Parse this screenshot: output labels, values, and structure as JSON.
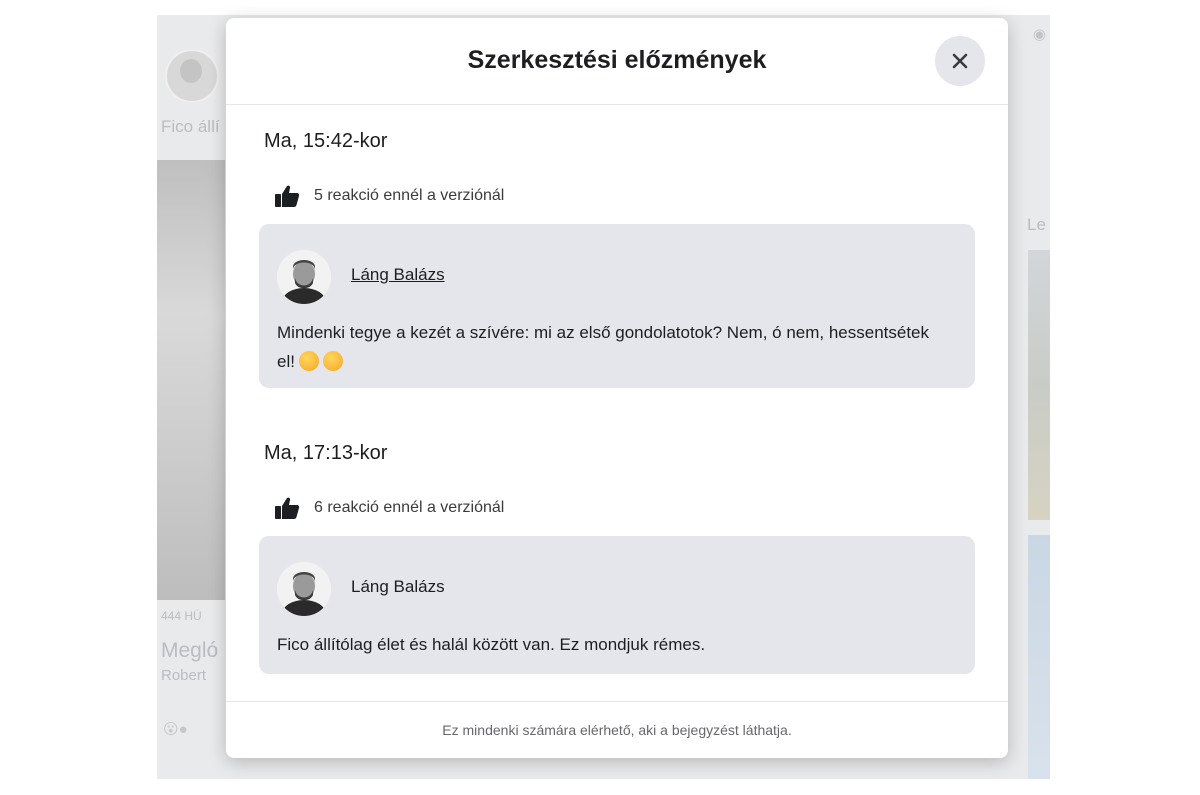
{
  "background": {
    "author_snippet": "Fico állí",
    "headline_snippet": "Megló",
    "subline_snippet": "Robert",
    "count_snippet": "444 HÚ",
    "side_snippet": "Le"
  },
  "modal": {
    "title": "Szerkesztési előzmények",
    "close_icon": "close-icon",
    "versions": [
      {
        "time": "Ma, 15:42-kor",
        "reactions": "5 reakció ennél a verziónál",
        "author": "Láng Balázs",
        "text": "Mindenki tegye a kezét a szívére: mi az első gondolatotok? Nem, ó nem, hessentsétek el!"
      },
      {
        "time": "Ma, 17:13-kor",
        "reactions": "6 reakció ennél a verziónál",
        "author": "Láng Balázs",
        "text": "Fico állítólag élet és halál között van. Ez mondjuk rémes."
      }
    ],
    "footer": "Ez mindenki számára elérhető, aki a bejegyzést láthatja."
  },
  "colors": {
    "post_background": "#e4e6eb",
    "overlay": "#e9eaec",
    "text": "#1c1e21"
  }
}
